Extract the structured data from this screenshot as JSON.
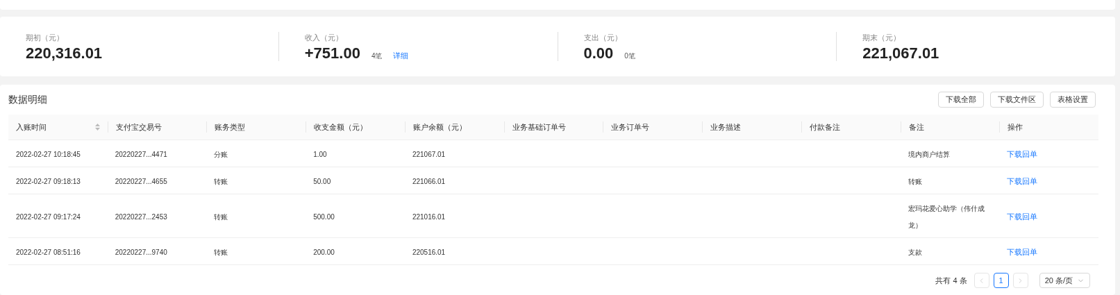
{
  "summary": [
    {
      "label": "期初（元）",
      "value": "220,316.01"
    },
    {
      "label": "收入（元）",
      "value": "+751.00",
      "count": "4笔",
      "link": "详细"
    },
    {
      "label": "支出（元）",
      "value": "0.00",
      "count": "0笔"
    },
    {
      "label": "期末（元）",
      "value": "221,067.01"
    }
  ],
  "table": {
    "title": "数据明细",
    "buttons": [
      "下载全部",
      "下载文件区",
      "表格设置"
    ],
    "columns": [
      {
        "label": "入账时间",
        "sortable": true
      },
      {
        "label": "支付宝交易号",
        "sortable": false
      },
      {
        "label": "账务类型",
        "sortable": false
      },
      {
        "label": "收支金额（元）",
        "sortable": false
      },
      {
        "label": "账户余额（元）",
        "sortable": false
      },
      {
        "label": "业务基础订单号",
        "sortable": false
      },
      {
        "label": "业务订单号",
        "sortable": false
      },
      {
        "label": "业务描述",
        "sortable": false
      },
      {
        "label": "付款备注",
        "sortable": false
      },
      {
        "label": "备注",
        "sortable": false
      },
      {
        "label": "操作",
        "sortable": false
      }
    ],
    "rows": [
      [
        "2022-02-27 10:18:45",
        "20220227...4471",
        "分账",
        "1.00",
        "221067.01",
        "",
        "",
        "",
        "",
        "境内商户结算",
        "下载回单"
      ],
      [
        "2022-02-27 09:18:13",
        "20220227...4655",
        "转账",
        "50.00",
        "221066.01",
        "",
        "",
        "",
        "",
        "转账",
        "下载回单"
      ],
      [
        "2022-02-27 09:17:24",
        "20220227...2453",
        "转账",
        "500.00",
        "221016.01",
        "",
        "",
        "",
        "",
        "宏玛花爱心助学（伟什成龙）",
        "下载回单"
      ],
      [
        "2022-02-27 08:51:16",
        "20220227...9740",
        "转账",
        "200.00",
        "220516.01",
        "",
        "",
        "",
        "",
        "支款",
        "下载回单"
      ]
    ]
  },
  "pagination": {
    "total": "共有 4 条",
    "prev": {
      "disabled": true
    },
    "pages": [
      {
        "label": "1",
        "selected": true
      }
    ],
    "next": {
      "disabled": true
    },
    "page_size": "20 条/页"
  }
}
